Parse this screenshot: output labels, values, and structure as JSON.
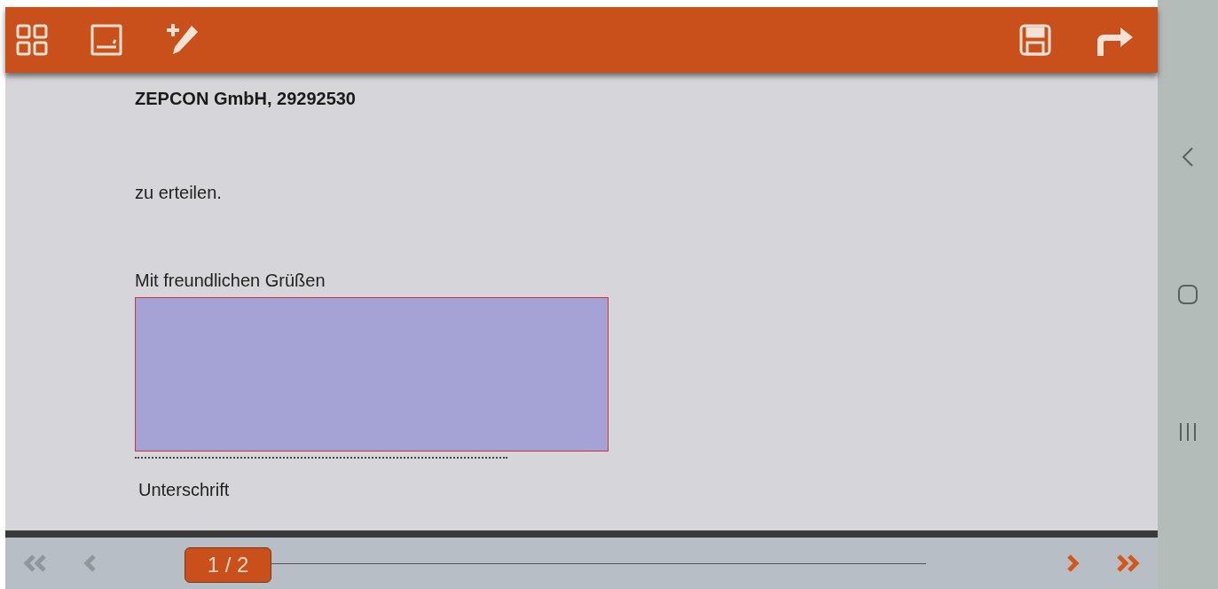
{
  "toolbar": {
    "left_buttons": [
      {
        "kind": "grid"
      },
      {
        "kind": "sign-pad"
      },
      {
        "kind": "add-signature"
      }
    ],
    "right_buttons": [
      {
        "kind": "save"
      },
      {
        "kind": "forward"
      }
    ]
  },
  "document": {
    "company": "ZEPCON GmbH, 29292530",
    "line": "zu erteilen.",
    "closing": "Mit freundlichen Grüßen",
    "signature_caption": "Unterschrift"
  },
  "pager": {
    "first_disabled": true,
    "prev_disabled": true,
    "next_disabled": false,
    "last_disabled": false,
    "page": "1 / 2",
    "level": 0
  },
  "system_nav": [
    {
      "kind": "back"
    },
    {
      "kind": "home"
    },
    {
      "kind": "recents"
    }
  ]
}
